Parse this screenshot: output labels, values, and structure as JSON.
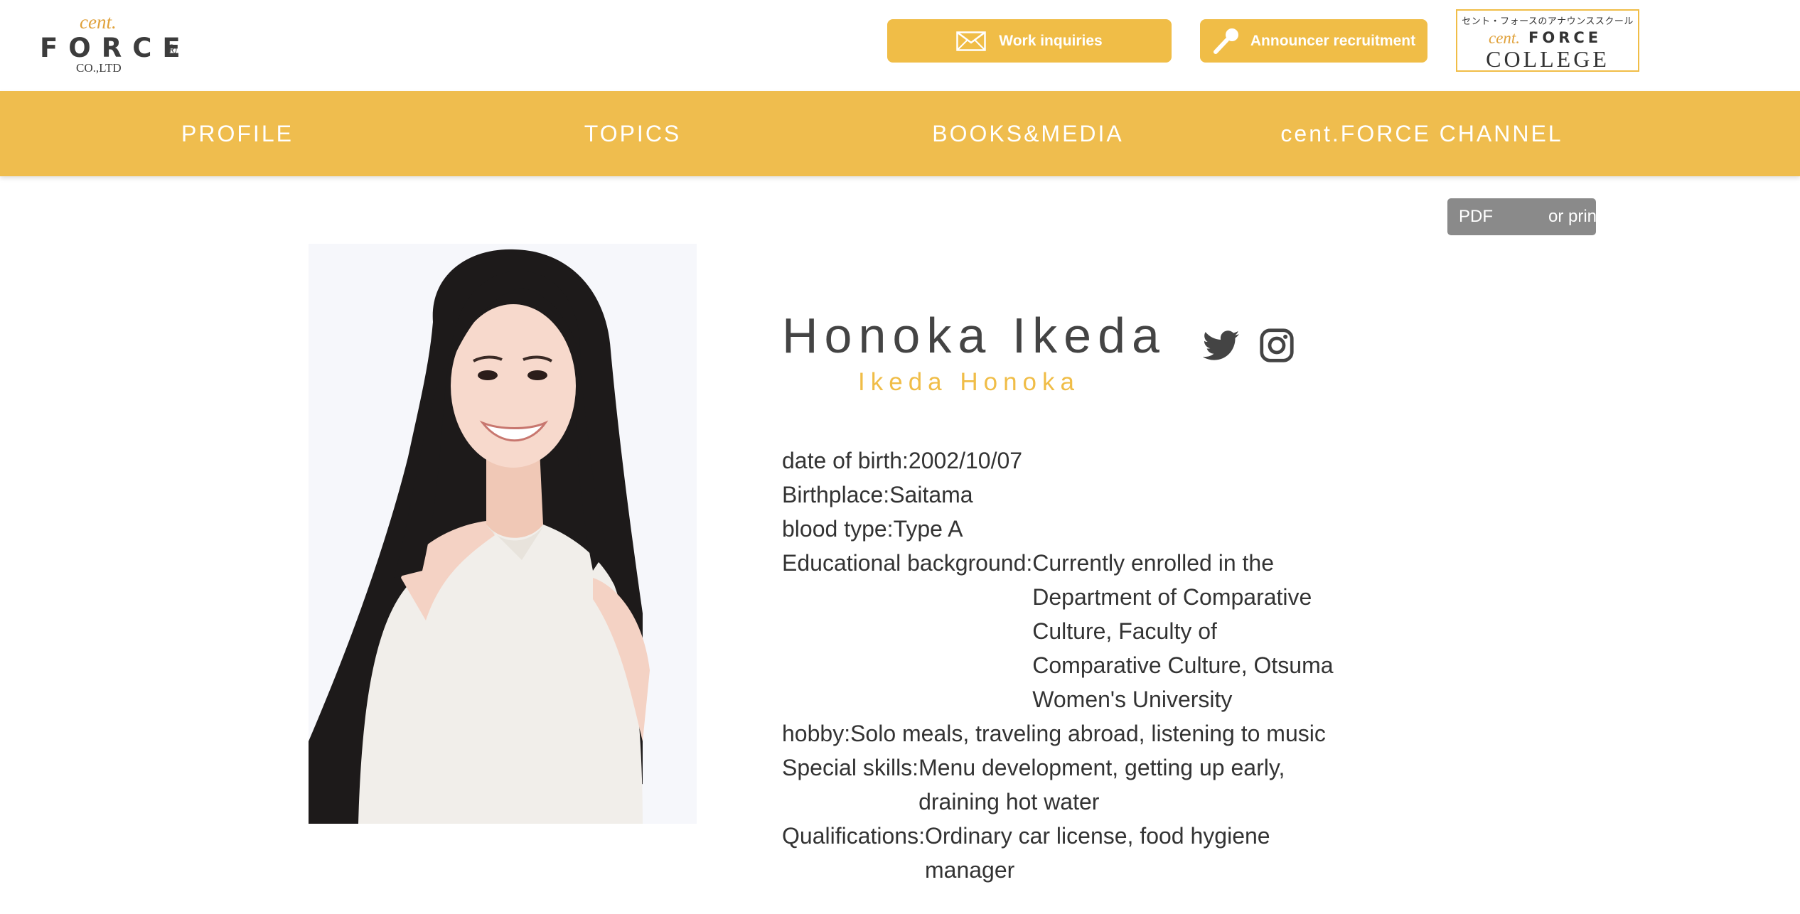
{
  "header": {
    "logo": {
      "cent": "cent.",
      "force": "FORCE",
      "registered": "®",
      "company": "CO.,LTD"
    },
    "work_label": "Work inquiries",
    "recruit_label": "Announcer recruitment",
    "college": {
      "tagline": "セント・フォースのアナウンススクール",
      "cent": "cent.",
      "force": "FORCE",
      "college": "COLLEGE"
    }
  },
  "nav": {
    "items": [
      {
        "label": "PROFILE"
      },
      {
        "label": "TOPICS"
      },
      {
        "label": "BOOKS&MEDIA"
      },
      {
        "label": "cent.FORCE CHANNEL"
      }
    ]
  },
  "pdf": {
    "label": "PDF",
    "print_label": "or printing"
  },
  "profile": {
    "name": "Honoka Ikeda",
    "romaji": "Ikeda Honoka",
    "details": [
      {
        "key": "date of birth:",
        "value": "2002/10/07"
      },
      {
        "key": "Birthplace:",
        "value": "Saitama"
      },
      {
        "key": "blood type:",
        "value": "Type A"
      },
      {
        "key": "Educational background:",
        "value": "Currently enrolled in the Department of Comparative Culture, Faculty of Comparative Culture, Otsuma Women's University"
      },
      {
        "key": "hobby:",
        "value": "Solo meals, traveling abroad, listening to music"
      },
      {
        "key": "Special skills:",
        "value": "Menu development, getting up early, draining hot water"
      },
      {
        "key": "Qualifications:",
        "value": "Ordinary car license, food hygiene manager"
      }
    ]
  },
  "icons": {
    "mail": "mail-icon",
    "microphone": "microphone-icon",
    "twitter": "twitter-icon",
    "instagram": "instagram-icon"
  },
  "colors": {
    "accent": "#efbd4e",
    "button": "#f0bd47",
    "logo_orange": "#e0a13a",
    "pdf_button": "#8a8a8a",
    "text": "#333333"
  }
}
